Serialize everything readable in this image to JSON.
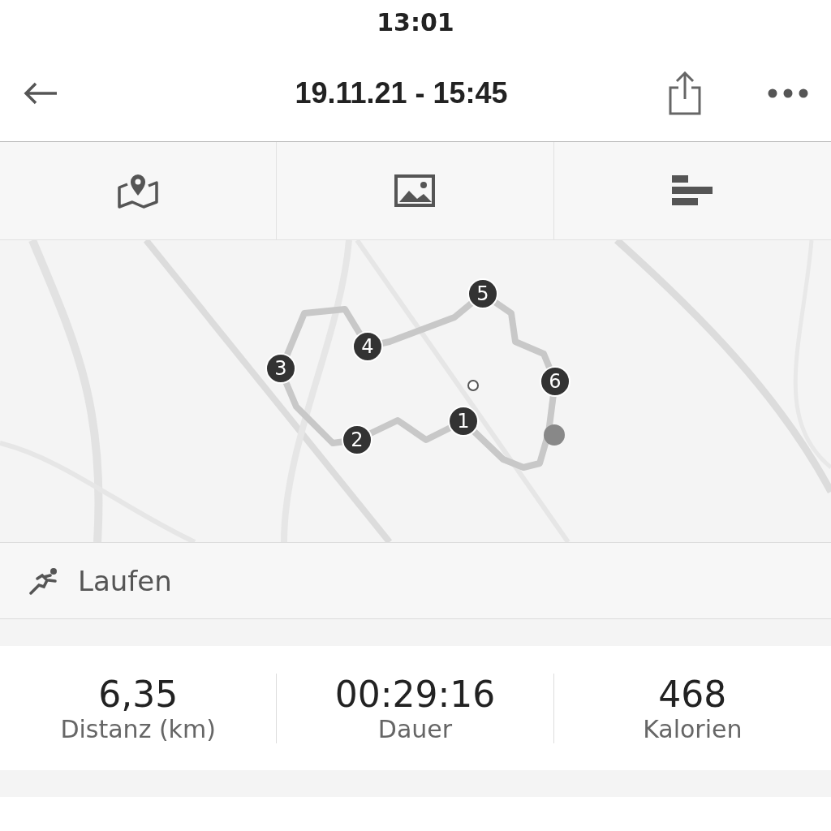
{
  "status_bar": {
    "time": "13:01"
  },
  "header": {
    "title": "19.11.21 - 15:45"
  },
  "map": {
    "kind": "picture",
    "markers": [
      {
        "label": "1"
      },
      {
        "label": "2"
      },
      {
        "label": "3"
      },
      {
        "label": "4"
      },
      {
        "label": "5"
      },
      {
        "label": "6"
      }
    ]
  },
  "activity": {
    "label": "Laufen"
  },
  "stats": [
    {
      "value": "6,35",
      "label": "Distanz (km)"
    },
    {
      "value": "00:29:16",
      "label": "Dauer"
    },
    {
      "value": "468",
      "label": "Kalorien"
    }
  ]
}
